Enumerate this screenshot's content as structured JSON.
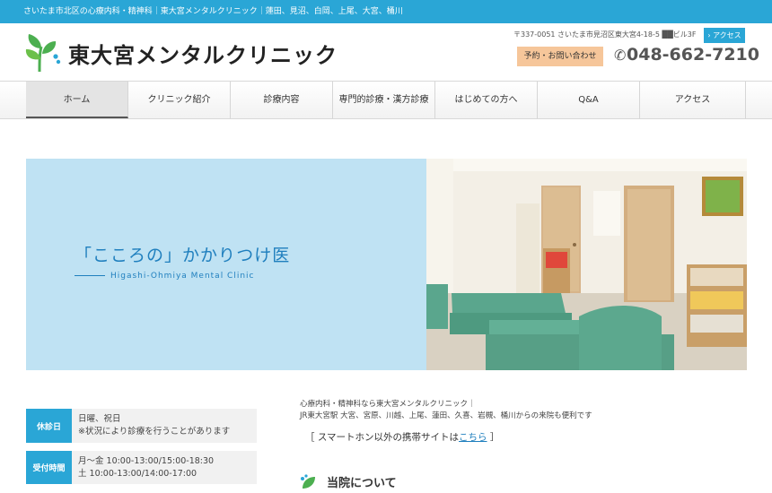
{
  "topbar": {
    "text": "さいたま市北区の心療内科・精神科｜東大宮メンタルクリニック｜蓮田、見沼、白岡、上尾、大宮、桶川"
  },
  "header": {
    "clinic_name": "東大宮メンタルクリニック",
    "address": "〒337-0051 さいたま市見沼区東大宮4-18-5 ██ビル3F",
    "access_label": "› アクセス",
    "contact_label": "予約・お問い合わせ",
    "phone": "048-662-7210"
  },
  "nav": {
    "items": [
      {
        "label": "ホーム"
      },
      {
        "label": "クリニック紹介"
      },
      {
        "label": "診療内容"
      },
      {
        "label": "専門的診療・漢方診療"
      },
      {
        "label": "はじめての方へ"
      },
      {
        "label": "Q&A"
      },
      {
        "label": "アクセス"
      }
    ]
  },
  "hero": {
    "title": "「こころの」かかりつけ医",
    "subtitle": "Higashi-Ohmiya Mental Clinic"
  },
  "info": {
    "closed_label": "休診日",
    "closed_line1": "日曜、祝日",
    "closed_line2": "※状況により診療を行うことがあります",
    "hours_label": "受付時間",
    "hours_line1": "月～金 10:00-13:00/15:00-18:30",
    "hours_line2": "土 10:00-13:00/14:00-17:00"
  },
  "intro": {
    "line1": "心療内科・精神科なら東大宮メンタルクリニック｜",
    "line2": "JR東大宮駅 大宮、宮原、川越、上尾、蓮田、久喜、岩槻、桶川からの来院も便利です"
  },
  "mobile_note": {
    "prefix": "［ スマートホン以外の携帯サイトは",
    "link": "こちら",
    "suffix": " ］"
  },
  "about": {
    "title": "当院について"
  },
  "colors": {
    "accent": "#2aa6d6",
    "logo_green": "#4caf50",
    "contact_bg": "#f6c69a",
    "hero_blue": "#bfe2f3"
  },
  "icons": {
    "logo": "leaf-logo-icon",
    "phone": "phone-icon",
    "section": "leaf-icon"
  }
}
